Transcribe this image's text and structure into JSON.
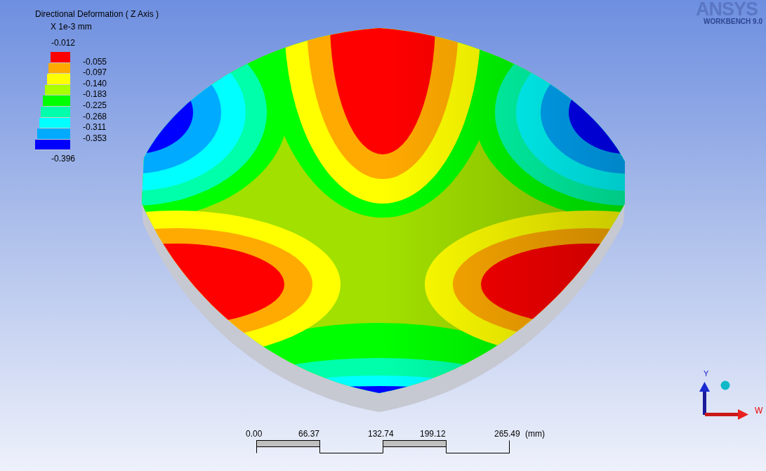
{
  "result": {
    "title": "Directional Deformation ( Z Axis )",
    "unit": "X 1e-3 mm"
  },
  "legend": {
    "max": "-0.012",
    "min": "-0.396",
    "bands": [
      {
        "color": "#ff0000",
        "label": "-0.055"
      },
      {
        "color": "#ffaa00",
        "label": "-0.097"
      },
      {
        "color": "#ffff00",
        "label": "-0.140"
      },
      {
        "color": "#aaff00",
        "label": "-0.183"
      },
      {
        "color": "#00ff00",
        "label": "-0.225"
      },
      {
        "color": "#00ffaa",
        "label": "-0.268"
      },
      {
        "color": "#00ffff",
        "label": "-0.311"
      },
      {
        "color": "#00aaff",
        "label": "-0.353"
      },
      {
        "color": "#0000ff"
      }
    ]
  },
  "logo": {
    "brand": "ANSYS",
    "product": "WORKBENCH 9.0"
  },
  "triad": {
    "up_label": "Y",
    "right_label": "W"
  },
  "scale_bar": {
    "ticks": [
      "0.00",
      "66.37",
      "132.74",
      "199.12",
      "265.49"
    ],
    "unit": "(mm)"
  }
}
